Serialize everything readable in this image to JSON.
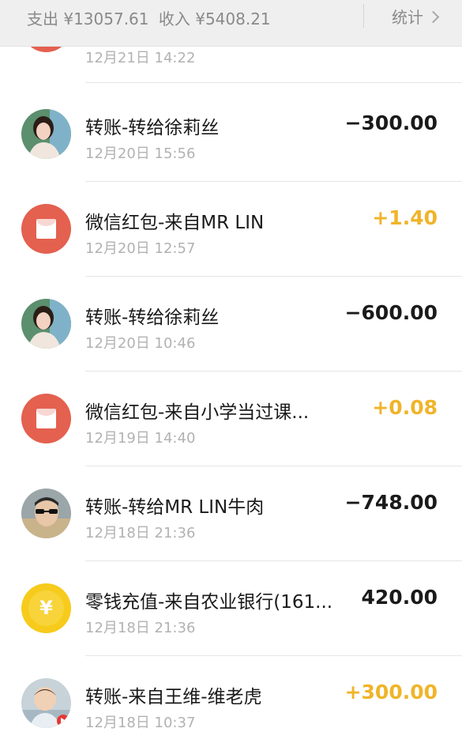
{
  "summary": {
    "expense": "支出 ¥13057.61",
    "income": "收入 ¥5408.21",
    "stats_label": "统计"
  },
  "transactions": [
    {
      "title": "",
      "time": "12月21日 14:22",
      "amount": "",
      "icon": "red-envelope-icon"
    },
    {
      "title": "转账-转给徐莉丝",
      "time": "12月20日 15:56",
      "amount": "−300.00",
      "icon": "avatar-photo"
    },
    {
      "title": "微信红包-来自MR LIN",
      "time": "12月20日 12:57",
      "amount": "+1.40",
      "icon": "red-envelope-icon"
    },
    {
      "title": "转账-转给徐莉丝",
      "time": "12月20日 10:46",
      "amount": "−600.00",
      "icon": "avatar-photo"
    },
    {
      "title": "微信红包-来自小学当过课...",
      "time": "12月19日 14:40",
      "amount": "+0.08",
      "icon": "red-envelope-icon"
    },
    {
      "title": "转账-转给MR LIN牛肉",
      "time": "12月18日 21:36",
      "amount": "−748.00",
      "icon": "avatar-photo"
    },
    {
      "title": "零钱充值-来自农业银行(161...",
      "time": "12月18日 21:36",
      "amount": "420.00",
      "icon": "yuan-coin-icon"
    },
    {
      "title": "转账-来自王维-维老虎",
      "time": "12月18日 10:37",
      "amount": "+300.00",
      "icon": "avatar-photo"
    }
  ],
  "colors": {
    "positive_amount": "#f0b429",
    "negative_amount": "#1a1a1a",
    "red_envelope": "#e4604f",
    "coin": "#f6cb1b"
  }
}
